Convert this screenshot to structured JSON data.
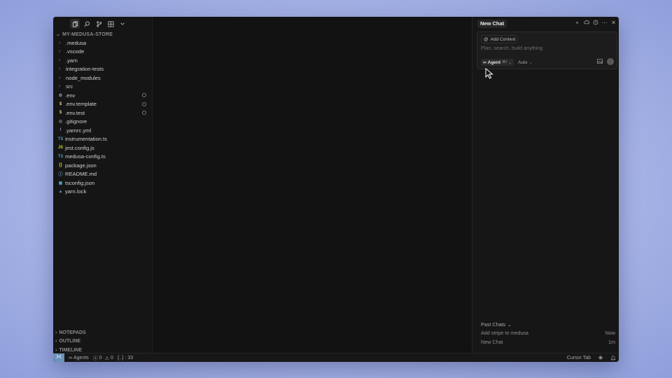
{
  "sidebar": {
    "toolbar": [
      "files-icon",
      "search-icon",
      "source-control-icon",
      "extensions-icon",
      "chevron-down-icon"
    ],
    "root_title": "MY-MEDUSA-STORE",
    "items": [
      {
        "label": ".medusa",
        "type": "folder"
      },
      {
        "label": ".vscode",
        "type": "folder"
      },
      {
        "label": ".yarn",
        "type": "folder"
      },
      {
        "label": "integration-tests",
        "type": "folder"
      },
      {
        "label": "node_modules",
        "type": "folder"
      },
      {
        "label": "src",
        "type": "folder"
      },
      {
        "label": ".env",
        "type": "file",
        "icon": "⚙",
        "icon_color": "#9aa0a6",
        "modified": true
      },
      {
        "label": ".env.template",
        "type": "file",
        "icon": "$",
        "icon_color": "#e2c08d",
        "modified": true
      },
      {
        "label": ".env.test",
        "type": "file",
        "icon": "$",
        "icon_color": "#e2c08d",
        "modified": true
      },
      {
        "label": ".gitignore",
        "type": "file",
        "icon": "◎",
        "icon_color": "#8a8a8a"
      },
      {
        "label": ".yarnrc.yml",
        "type": "file",
        "icon": "!",
        "icon_color": "#c9a0dc"
      },
      {
        "label": "instrumentation.ts",
        "type": "file",
        "icon": "TS",
        "icon_color": "#519aba"
      },
      {
        "label": "jest.config.js",
        "type": "file",
        "icon": "JS",
        "icon_color": "#cbcb41"
      },
      {
        "label": "medusa-config.ts",
        "type": "file",
        "icon": "TS",
        "icon_color": "#519aba"
      },
      {
        "label": "package.json",
        "type": "file",
        "icon": "{}",
        "icon_color": "#cbcb41"
      },
      {
        "label": "README.md",
        "type": "file",
        "icon": "ⓘ",
        "icon_color": "#519aba"
      },
      {
        "label": "tsconfig.json",
        "type": "file",
        "icon": "▣",
        "icon_color": "#519aba"
      },
      {
        "label": "yarn.lock",
        "type": "file",
        "icon": "▲",
        "icon_color": "#6c93b8"
      }
    ],
    "bottom_sections": [
      "NOTEPADS",
      "OUTLINE",
      "TIMELINE"
    ]
  },
  "chat": {
    "tab_label": "New Chat",
    "header_icons": [
      "plus-icon",
      "cloud-icon",
      "history-icon",
      "more-icon",
      "close-icon"
    ],
    "add_context_label": "Add Context",
    "placeholder": "Plan, search, build anything",
    "mode_label": "Agent",
    "mode_shortcut": "⌘I",
    "model_label": "Auto",
    "past_title": "Past Chats",
    "past_chats": [
      {
        "title": "Add stripe to medusa",
        "time": "Now"
      },
      {
        "title": "New Chat",
        "time": "1m"
      }
    ]
  },
  "statusbar": {
    "remote": "⨯⨯",
    "agents_label": "Agents",
    "errors": "0",
    "warnings": "0",
    "ports": "{..} : 33",
    "cursor_tab": "Cursor Tab"
  },
  "colors": {
    "accent_remote": "#6c93b8",
    "window_bg": "#141414"
  }
}
